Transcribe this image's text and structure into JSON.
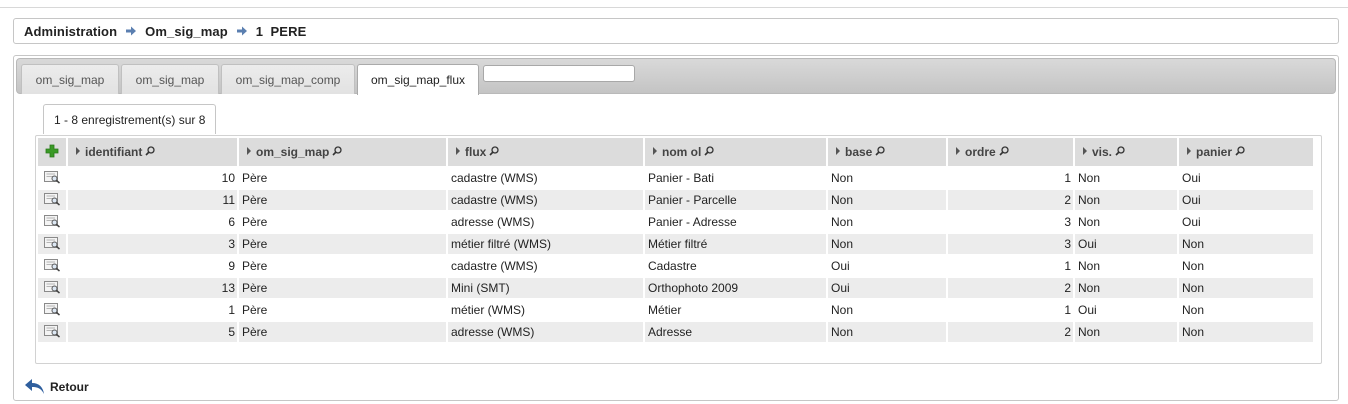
{
  "breadcrumb": {
    "items": [
      "Administration",
      "Om_sig_map",
      "1  PERE"
    ]
  },
  "tabs": [
    {
      "label": "om_sig_map",
      "active": false
    },
    {
      "label": "om_sig_map",
      "active": false
    },
    {
      "label": "om_sig_map_comp",
      "active": false
    },
    {
      "label": "om_sig_map_flux",
      "active": true
    }
  ],
  "tab_search": {
    "value": "",
    "placeholder": ""
  },
  "pagination": {
    "text": "1 - 8 enregistrement(s) sur 8"
  },
  "table": {
    "columns": [
      "identifiant",
      "om_sig_map",
      "flux",
      "nom ol",
      "base",
      "ordre",
      "vis.",
      "panier"
    ],
    "rows": [
      {
        "identifiant": "10",
        "om_sig_map": "Père",
        "flux": "cadastre (WMS)",
        "nom_ol": "Panier - Bati",
        "base": "Non",
        "ordre": "1",
        "vis": "Non",
        "panier": "Oui"
      },
      {
        "identifiant": "11",
        "om_sig_map": "Père",
        "flux": "cadastre (WMS)",
        "nom_ol": "Panier - Parcelle",
        "base": "Non",
        "ordre": "2",
        "vis": "Non",
        "panier": "Oui"
      },
      {
        "identifiant": "6",
        "om_sig_map": "Père",
        "flux": "adresse (WMS)",
        "nom_ol": "Panier - Adresse",
        "base": "Non",
        "ordre": "3",
        "vis": "Non",
        "panier": "Oui"
      },
      {
        "identifiant": "3",
        "om_sig_map": "Père",
        "flux": "métier filtré (WMS)",
        "nom_ol": "Métier filtré",
        "base": "Non",
        "ordre": "3",
        "vis": "Oui",
        "panier": "Non"
      },
      {
        "identifiant": "9",
        "om_sig_map": "Père",
        "flux": "cadastre (WMS)",
        "nom_ol": "Cadastre",
        "base": "Oui",
        "ordre": "1",
        "vis": "Non",
        "panier": "Non"
      },
      {
        "identifiant": "13",
        "om_sig_map": "Père",
        "flux": "Mini (SMT)",
        "nom_ol": "Orthophoto 2009",
        "base": "Oui",
        "ordre": "2",
        "vis": "Non",
        "panier": "Non"
      },
      {
        "identifiant": "1",
        "om_sig_map": "Père",
        "flux": "métier (WMS)",
        "nom_ol": "Métier",
        "base": "Non",
        "ordre": "1",
        "vis": "Oui",
        "panier": "Non"
      },
      {
        "identifiant": "5",
        "om_sig_map": "Père",
        "flux": "adresse (WMS)",
        "nom_ol": "Adresse",
        "base": "Non",
        "ordre": "2",
        "vis": "Non",
        "panier": "Non"
      }
    ]
  },
  "footer": {
    "back_label": "Retour"
  },
  "icons": {
    "breadcrumb_separator": "arrow-right-icon",
    "add": "plus-icon",
    "row_action": "view-record-icon",
    "sort": "sort-triangle-icon",
    "search": "magnifier-icon",
    "back": "back-arrow-icon"
  },
  "colors": {
    "add_icon": "#3a9a26",
    "separator_arrow": "#5b7fb0",
    "back_arrow": "#2f5f9e",
    "header_bg": "#dcdcdc",
    "alt_row_bg": "#ececec"
  }
}
